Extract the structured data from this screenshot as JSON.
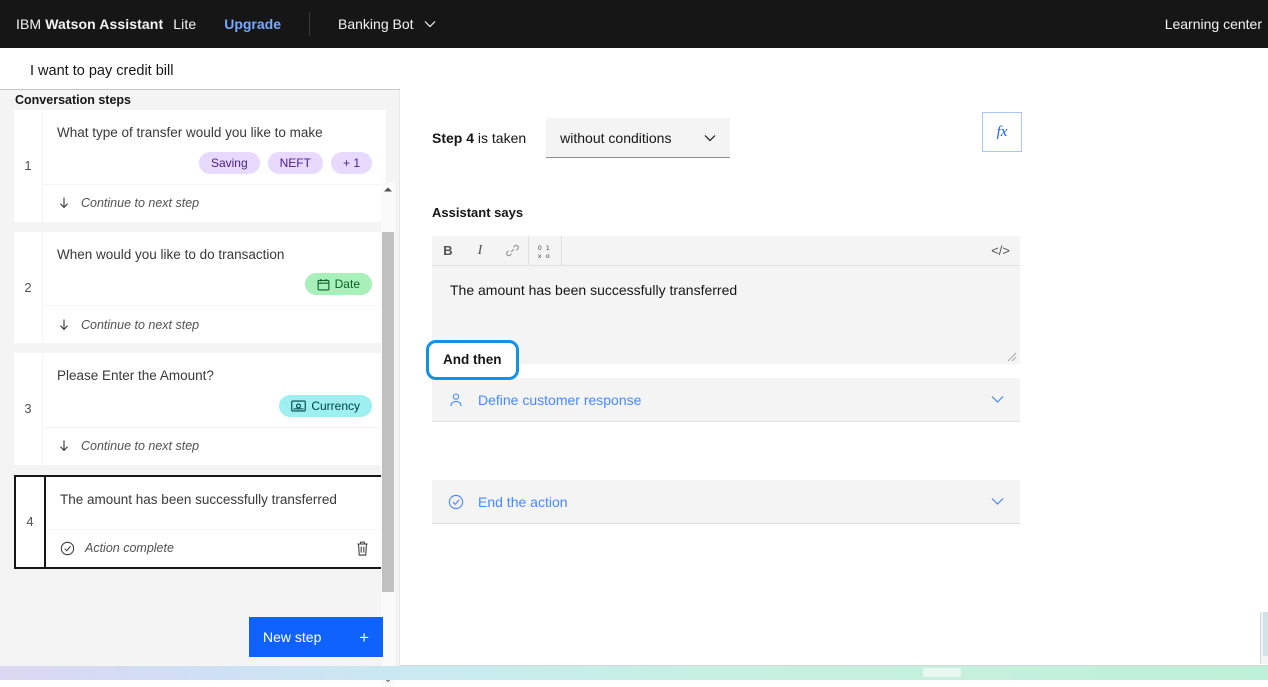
{
  "topbar": {
    "brand_ibm": "IBM",
    "brand_product": "Watson Assistant",
    "plan": "Lite",
    "upgrade": "Upgrade",
    "bot_name": "Banking Bot",
    "bot_chevron_icon": "chevron-down-icon",
    "learning_center": "Learning center"
  },
  "action": {
    "title": "I want to pay credit bill"
  },
  "sidebar": {
    "heading": "Conversation steps",
    "steps": [
      {
        "number": "1",
        "question": "What type of transfer would you like to make",
        "chips": [
          {
            "label": "Saving",
            "style": "purple",
            "icon": ""
          },
          {
            "label": "NEFT",
            "style": "purple",
            "icon": ""
          },
          {
            "label": "+ 1",
            "style": "purple",
            "icon": ""
          }
        ],
        "footer_icon": "arrow-down-icon",
        "footer_label": "Continue to next step",
        "selected": false,
        "has_trash": false
      },
      {
        "number": "2",
        "question": "When would you like to do transaction",
        "chips": [
          {
            "label": "Date",
            "style": "green",
            "icon": "calendar-icon"
          }
        ],
        "footer_icon": "arrow-down-icon",
        "footer_label": "Continue to next step",
        "selected": false,
        "has_trash": false
      },
      {
        "number": "3",
        "question": "Please Enter the Amount?",
        "chips": [
          {
            "label": "Currency",
            "style": "teal",
            "icon": "currency-icon"
          }
        ],
        "footer_icon": "arrow-down-icon",
        "footer_label": "Continue to next step",
        "selected": false,
        "has_trash": false
      },
      {
        "number": "4",
        "question": "The amount has been successfully transferred",
        "chips": [],
        "footer_icon": "check-circle-icon",
        "footer_label": "Action complete",
        "selected": true,
        "has_trash": true,
        "trash_icon": "trash-icon"
      }
    ],
    "scrollbar": {
      "up_icon": "caret-up-icon",
      "down_icon": "caret-down-icon"
    },
    "new_step_button": {
      "label": "New step",
      "plus_icon": "plus-icon"
    }
  },
  "main": {
    "condition": {
      "prefix_bold": "Step 4",
      "prefix_rest": " is taken",
      "select_value": "without conditions",
      "select_chevron_icon": "chevron-down-icon"
    },
    "fx_button": {
      "label": "fx",
      "icon": "function-icon"
    },
    "assistant_says_label": "Assistant says",
    "editor": {
      "toolbar": [
        {
          "name": "bold-button",
          "label": "B"
        },
        {
          "name": "italic-button",
          "label": "I"
        },
        {
          "name": "link-button",
          "label": "link-icon"
        },
        {
          "name": "variable-button",
          "label": "variable-icon"
        }
      ],
      "code_view_label": "</>",
      "text": "The amount has been successfully transferred"
    },
    "customer_response": {
      "icon": "user-icon",
      "label": "Define customer response",
      "chevron_icon": "chevron-down-icon"
    },
    "and_then_label": "And then",
    "end_action": {
      "icon": "check-circle-icon",
      "label": "End the action",
      "chevron_icon": "chevron-down-icon"
    }
  },
  "colors": {
    "header_bg": "#161616",
    "accent_blue": "#0f62fe",
    "link_blue": "#4589ff",
    "highlight_cyan": "#1192e8",
    "chip_purple": "#e8daff",
    "chip_green": "#a7f0ba",
    "chip_teal": "#9ef0f0"
  }
}
